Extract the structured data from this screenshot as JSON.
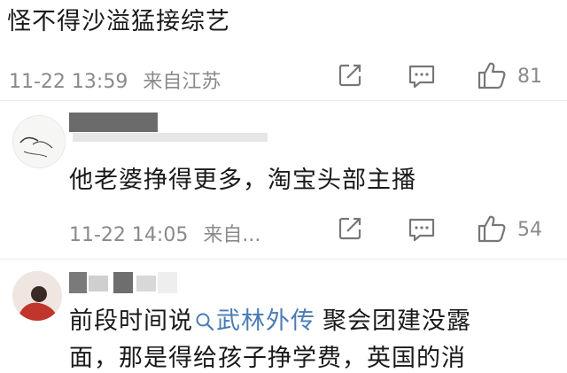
{
  "comments": [
    {
      "text": "怪不得沙溢猛接综艺",
      "timestamp": "11-22 13:59",
      "location": "来自江苏",
      "likes": "81"
    },
    {
      "text": "他老婆挣得更多，淘宝头部主播",
      "timestamp": "11-22 14:05",
      "location": "来自...",
      "likes": "54"
    },
    {
      "text_before_link": "前段时间说",
      "topic_link": "武林外传",
      "text_after_link": "聚会团建没露",
      "text_line2": "面，那是得给孩子挣学费，英国的消"
    }
  ],
  "colors": {
    "meta_gray": "#8a8a8a",
    "link_blue": "#4a7bb7",
    "divider": "#ececec"
  }
}
